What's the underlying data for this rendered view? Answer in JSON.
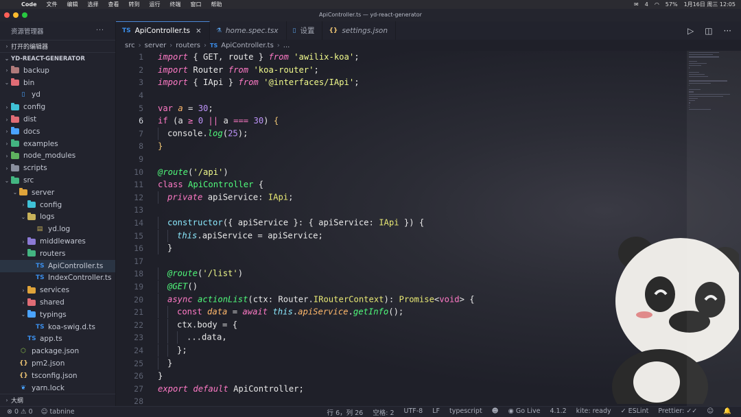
{
  "menubar": {
    "app": "Code",
    "menus": [
      "文件",
      "编辑",
      "选择",
      "查看",
      "转到",
      "运行",
      "终端",
      "窗口",
      "帮助"
    ],
    "status_items": [
      "4",
      "57%",
      "1月16日 周三 12:05"
    ]
  },
  "window": {
    "title": "ApiController.ts — yd-react-generator"
  },
  "sidebar": {
    "title": "资源管理器",
    "more": "···",
    "open_editors": "打开的编辑器",
    "project": "YD-REACT-GENERATOR",
    "tree": [
      {
        "label": "backup",
        "depth": 0,
        "chev": "›",
        "kind": "folder",
        "color": "#b07a7a"
      },
      {
        "label": "bin",
        "depth": 0,
        "chev": "⌄",
        "kind": "folder",
        "color": "#e06c75"
      },
      {
        "label": "yd",
        "depth": 1,
        "chev": "",
        "kind": "file",
        "color": "#4aa3ff",
        "glyph": "▯"
      },
      {
        "label": "config",
        "depth": 0,
        "chev": "›",
        "kind": "folder",
        "color": "#3fc1d6"
      },
      {
        "label": "dist",
        "depth": 0,
        "chev": "›",
        "kind": "folder",
        "color": "#e06c75"
      },
      {
        "label": "docs",
        "depth": 0,
        "chev": "›",
        "kind": "folder",
        "color": "#4aa3ff"
      },
      {
        "label": "examples",
        "depth": 0,
        "chev": "›",
        "kind": "folder",
        "color": "#43b581"
      },
      {
        "label": "node_modules",
        "depth": 0,
        "chev": "›",
        "kind": "folder",
        "color": "#5fb35f"
      },
      {
        "label": "scripts",
        "depth": 0,
        "chev": "›",
        "kind": "folder",
        "color": "#8a8f9e"
      },
      {
        "label": "src",
        "depth": 0,
        "chev": "⌄",
        "kind": "folder",
        "color": "#43b581"
      },
      {
        "label": "server",
        "depth": 1,
        "chev": "⌄",
        "kind": "folder",
        "color": "#e0a43a"
      },
      {
        "label": "config",
        "depth": 2,
        "chev": "›",
        "kind": "folder",
        "color": "#3fc1d6"
      },
      {
        "label": "logs",
        "depth": 2,
        "chev": "⌄",
        "kind": "folder",
        "color": "#c8b25a"
      },
      {
        "label": "yd.log",
        "depth": 3,
        "chev": "",
        "kind": "file",
        "color": "#c8b25a",
        "glyph": "▤"
      },
      {
        "label": "middlewares",
        "depth": 2,
        "chev": "›",
        "kind": "folder",
        "color": "#8c7ad6"
      },
      {
        "label": "routers",
        "depth": 2,
        "chev": "⌄",
        "kind": "folder",
        "color": "#43b581"
      },
      {
        "label": "ApiController.ts",
        "depth": 3,
        "chev": "",
        "kind": "file",
        "color": "#3b8eea",
        "glyph": "TS",
        "active": true
      },
      {
        "label": "IndexController.ts",
        "depth": 3,
        "chev": "",
        "kind": "file",
        "color": "#3b8eea",
        "glyph": "TS"
      },
      {
        "label": "services",
        "depth": 2,
        "chev": "›",
        "kind": "folder",
        "color": "#e0a43a"
      },
      {
        "label": "shared",
        "depth": 2,
        "chev": "›",
        "kind": "folder",
        "color": "#e06c75"
      },
      {
        "label": "typings",
        "depth": 2,
        "chev": "⌄",
        "kind": "folder",
        "color": "#4aa3ff"
      },
      {
        "label": "koa-swig.d.ts",
        "depth": 3,
        "chev": "",
        "kind": "file",
        "color": "#3b8eea",
        "glyph": "TS"
      },
      {
        "label": "app.ts",
        "depth": 2,
        "chev": "",
        "kind": "file",
        "color": "#3b8eea",
        "glyph": "TS"
      },
      {
        "label": "package.json",
        "depth": 1,
        "chev": "",
        "kind": "file",
        "color": "#8bc34a",
        "glyph": "⬡"
      },
      {
        "label": "pm2.json",
        "depth": 1,
        "chev": "",
        "kind": "file",
        "color": "#f0c674",
        "glyph": "{}"
      },
      {
        "label": "tsconfig.json",
        "depth": 1,
        "chev": "",
        "kind": "file",
        "color": "#f0c674",
        "glyph": "{}"
      },
      {
        "label": "yarn.lock",
        "depth": 1,
        "chev": "",
        "kind": "file",
        "color": "#4aa3ff",
        "glyph": "❦"
      }
    ],
    "outline": "大纲"
  },
  "tabs": [
    {
      "label": "ApiController.ts",
      "icon": "TS",
      "icon_color": "#3b8eea",
      "active": true,
      "close": "×"
    },
    {
      "label": "home.spec.tsx",
      "icon": "⚗",
      "icon_color": "#5aa0e6",
      "italic": true
    },
    {
      "label": "设置",
      "icon": "▯",
      "icon_color": "#5aa0e6"
    },
    {
      "label": "settings.json",
      "icon": "{}",
      "icon_color": "#f0c674"
    }
  ],
  "breadcrumb": [
    "src",
    "server",
    "routers",
    "ApiController.ts",
    "..."
  ],
  "editor": {
    "current_line": 6,
    "lines": [
      [
        [
          "k",
          "import"
        ],
        [
          "pl",
          " { GET, route } "
        ],
        [
          "k",
          "from"
        ],
        [
          "pl",
          " "
        ],
        [
          "s",
          "'awilix-koa'"
        ],
        [
          "pl",
          ";"
        ]
      ],
      [
        [
          "k",
          "import"
        ],
        [
          "pl",
          " Router "
        ],
        [
          "k",
          "from"
        ],
        [
          "pl",
          " "
        ],
        [
          "s",
          "'koa-router'"
        ],
        [
          "pl",
          ";"
        ]
      ],
      [
        [
          "k",
          "import"
        ],
        [
          "pl",
          " { IApi } "
        ],
        [
          "k",
          "from"
        ],
        [
          "pl",
          " "
        ],
        [
          "s",
          "'@interfaces/IApi'"
        ],
        [
          "pl",
          ";"
        ]
      ],
      [],
      [
        [
          "k2",
          "var"
        ],
        [
          "pl",
          " "
        ],
        [
          "pa",
          "a"
        ],
        [
          "pl",
          " = "
        ],
        [
          "n",
          "30"
        ],
        [
          "pl",
          ";"
        ]
      ],
      [
        [
          "k2",
          "if"
        ],
        [
          "pl",
          " (a "
        ],
        [
          "k2",
          "≥"
        ],
        [
          "pl",
          " "
        ],
        [
          "n",
          "0"
        ],
        [
          "pl",
          " "
        ],
        [
          "k2",
          "||"
        ],
        [
          "pl",
          " a "
        ],
        [
          "k2",
          "==="
        ],
        [
          "pl",
          " "
        ],
        [
          "n",
          "30"
        ],
        [
          "pl",
          ") "
        ],
        [
          "br",
          "{"
        ]
      ],
      [
        [
          "ig",
          ""
        ],
        [
          "pl",
          "console."
        ],
        [
          "fi2",
          "log"
        ],
        [
          "pl",
          "("
        ],
        [
          "n",
          "25"
        ],
        [
          "pl",
          ");"
        ]
      ],
      [
        [
          "br",
          "}"
        ]
      ],
      [],
      [
        [
          "dec",
          "@route"
        ],
        [
          "pl",
          "("
        ],
        [
          "s",
          "'/api'"
        ],
        [
          "pl",
          ")"
        ]
      ],
      [
        [
          "k2",
          "class"
        ],
        [
          "pl",
          " "
        ],
        [
          "f",
          "ApiController"
        ],
        [
          "pl",
          " {"
        ]
      ],
      [
        [
          "ig",
          ""
        ],
        [
          "k",
          "private"
        ],
        [
          "pl",
          " apiService: "
        ],
        [
          "ty",
          "IApi"
        ],
        [
          "pl",
          ";"
        ]
      ],
      [],
      [
        [
          "ig",
          ""
        ],
        [
          "cl",
          "constructor"
        ],
        [
          "pl",
          "({ apiService }: { apiService: "
        ],
        [
          "ty",
          "IApi"
        ],
        [
          "pl",
          " }) {"
        ]
      ],
      [
        [
          "ig",
          ""
        ],
        [
          "ig",
          ""
        ],
        [
          "t",
          "this"
        ],
        [
          "pl",
          ".apiService = apiService;"
        ]
      ],
      [
        [
          "ig",
          ""
        ],
        [
          "pl",
          "}"
        ]
      ],
      [],
      [
        [
          "ig",
          ""
        ],
        [
          "dec",
          "@route"
        ],
        [
          "pl",
          "("
        ],
        [
          "s",
          "'/list'"
        ],
        [
          "pl",
          ")"
        ]
      ],
      [
        [
          "ig",
          ""
        ],
        [
          "dec",
          "@GET"
        ],
        [
          "pl",
          "()"
        ]
      ],
      [
        [
          "ig",
          ""
        ],
        [
          "k",
          "async"
        ],
        [
          "pl",
          " "
        ],
        [
          "fi2",
          "actionList"
        ],
        [
          "pl",
          "(ctx: Router."
        ],
        [
          "ty",
          "IRouterContext"
        ],
        [
          "pl",
          "): "
        ],
        [
          "ty",
          "Promise"
        ],
        [
          "pl",
          "<"
        ],
        [
          "k2",
          "void"
        ],
        [
          "pl",
          "> {"
        ]
      ],
      [
        [
          "ig",
          ""
        ],
        [
          "ig",
          ""
        ],
        [
          "k2",
          "const"
        ],
        [
          "pl",
          " "
        ],
        [
          "pa",
          "data"
        ],
        [
          "pl",
          " = "
        ],
        [
          "k",
          "await"
        ],
        [
          "pl",
          " "
        ],
        [
          "t",
          "this"
        ],
        [
          "pl",
          "."
        ],
        [
          "pa",
          "apiService"
        ],
        [
          "pl",
          "."
        ],
        [
          "fi2",
          "getInfo"
        ],
        [
          "pl",
          "();"
        ]
      ],
      [
        [
          "ig",
          ""
        ],
        [
          "ig",
          ""
        ],
        [
          "pl",
          "ctx.body = {"
        ]
      ],
      [
        [
          "ig",
          ""
        ],
        [
          "ig",
          ""
        ],
        [
          "ig",
          ""
        ],
        [
          "pl",
          "...data,"
        ]
      ],
      [
        [
          "ig",
          ""
        ],
        [
          "ig",
          ""
        ],
        [
          "pl",
          "};"
        ]
      ],
      [
        [
          "ig",
          ""
        ],
        [
          "pl",
          "}"
        ]
      ],
      [
        [
          "pl",
          "}"
        ]
      ],
      [
        [
          "k",
          "export"
        ],
        [
          "pl",
          " "
        ],
        [
          "k",
          "default"
        ],
        [
          "pl",
          " ApiController;"
        ]
      ],
      []
    ]
  },
  "statusbar": {
    "left": [
      "⊗ 0  ⚠ 0",
      "☺ tabnine"
    ],
    "right": [
      "行 6，列 26",
      "空格: 2",
      "UTF-8",
      "LF",
      "typescript",
      "☻",
      "◉ Go Live",
      "4.1.2",
      "kite: ready",
      "✓ ESLint",
      "Prettier: ✓✓",
      "☺",
      "🔔"
    ]
  },
  "colors": {
    "accent": "#4b89d8",
    "editor_bg": "#1f2029",
    "sidebar_bg": "#22232d"
  }
}
